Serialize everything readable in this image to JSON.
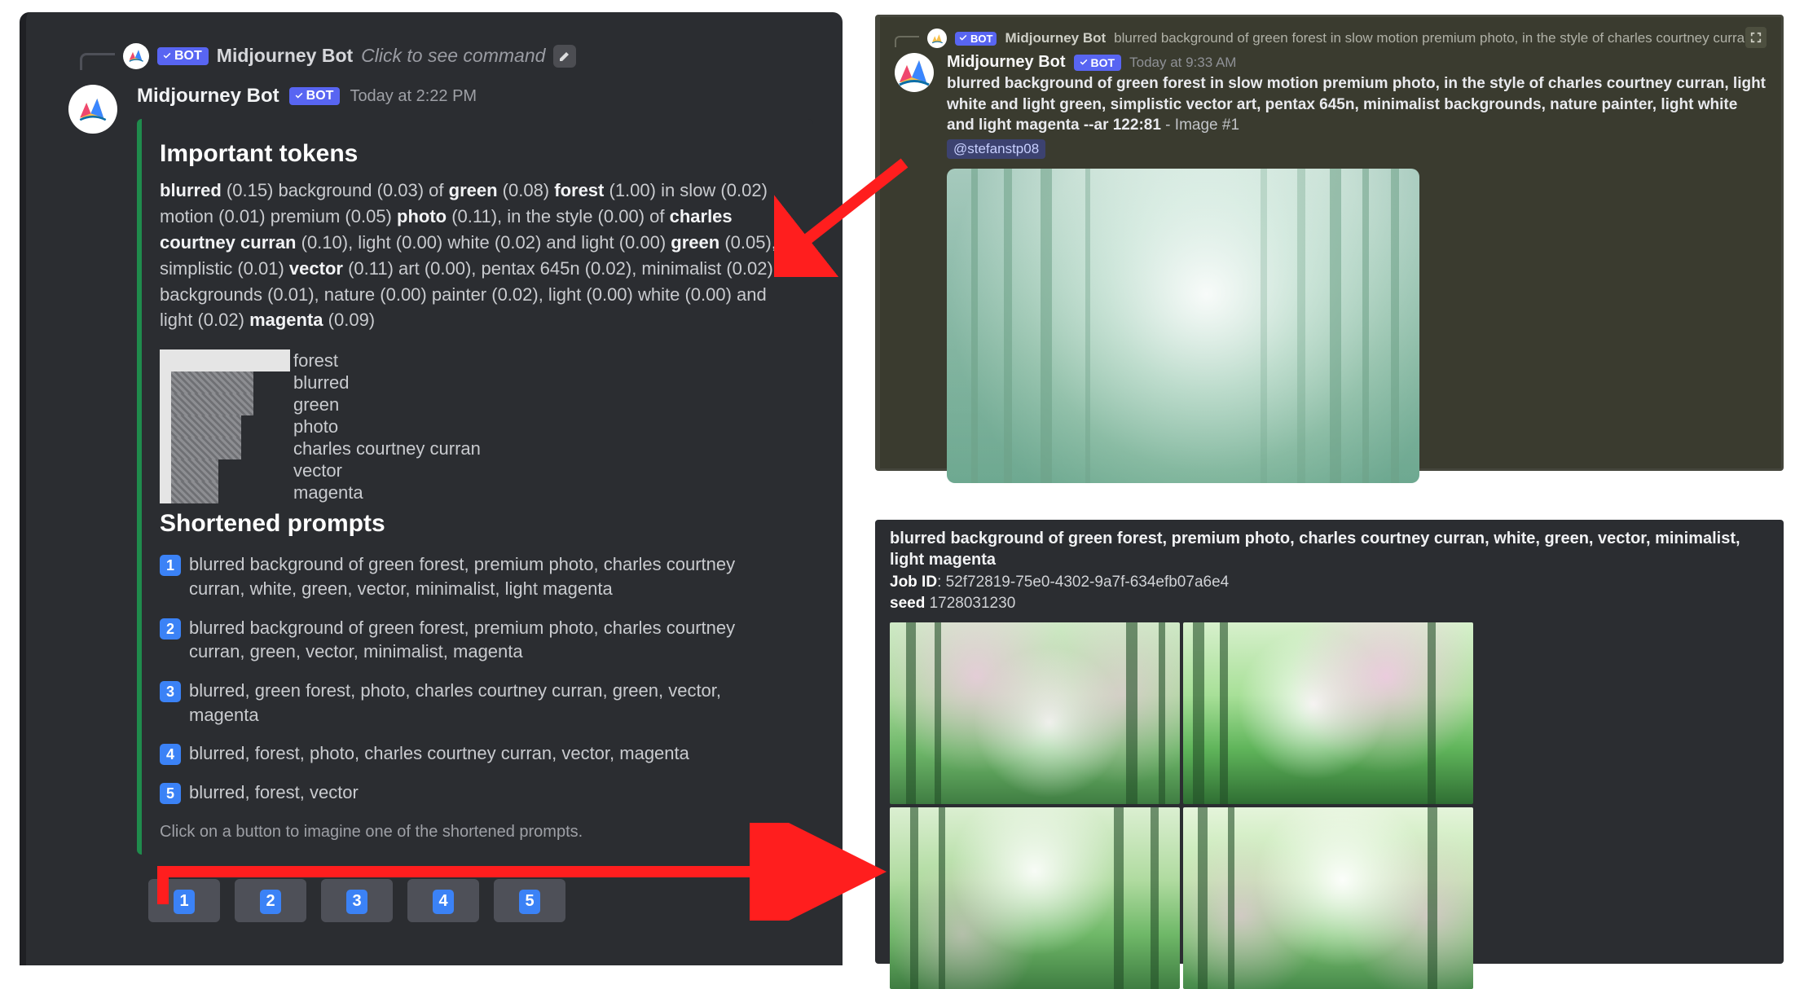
{
  "left": {
    "mention": {
      "bot_tag": "BOT",
      "name": "Midjourney Bot",
      "click_hint": "Click to see command"
    },
    "header": {
      "name": "Midjourney Bot",
      "bot_tag": "BOT",
      "time": "Today at 2:22 PM"
    },
    "embed": {
      "heading1": "Important tokens",
      "tokens": [
        {
          "t": "blurred",
          "b": true
        },
        {
          "t": " (0.15) background (0.03) of "
        },
        {
          "t": "green",
          "b": true
        },
        {
          "t": " (0.08) "
        },
        {
          "t": "forest",
          "b": true
        },
        {
          "t": " (1.00) in slow (0.02) motion (0.01) premium (0.05) "
        },
        {
          "t": "photo",
          "b": true
        },
        {
          "t": " (0.11), in the style (0.00) of "
        },
        {
          "t": "charles courtney curran",
          "b": true
        },
        {
          "t": " (0.10), light (0.00) white (0.02) and light (0.00) "
        },
        {
          "t": "green",
          "b": true
        },
        {
          "t": " (0.05), simplistic (0.01) "
        },
        {
          "t": "vector",
          "b": true
        },
        {
          "t": " (0.11) art (0.00), pentax 645n (0.02), minimalist (0.02) backgrounds (0.01), nature (0.00) painter (0.02), light (0.00) white (0.00) and light (0.02) "
        },
        {
          "t": "magenta",
          "b": true
        },
        {
          "t": " (0.09)"
        }
      ],
      "bars": [
        {
          "label": "forest",
          "solid": 160,
          "dim": 0
        },
        {
          "label": "blurred",
          "solid": 14,
          "dim": 101
        },
        {
          "label": "green",
          "solid": 14,
          "dim": 101
        },
        {
          "label": "photo",
          "solid": 14,
          "dim": 86
        },
        {
          "label": "charles courtney curran",
          "solid": 14,
          "dim": 86
        },
        {
          "label": "vector",
          "solid": 14,
          "dim": 58
        },
        {
          "label": "magenta",
          "solid": 14,
          "dim": 58
        }
      ],
      "heading2": "Shortened prompts",
      "shortened": [
        "blurred background of green forest, premium photo, charles courtney curran, white, green, vector, minimalist, light magenta",
        "blurred background of green forest, premium photo, charles courtney curran, green, vector, minimalist, magenta",
        "blurred, green forest, photo, charles courtney curran, green, vector, magenta",
        "blurred, forest, photo, charles courtney curran, vector, magenta",
        "blurred, forest, vector"
      ],
      "hint": "Click on a button to imagine one of the shortened prompts."
    },
    "buttons": [
      "1",
      "2",
      "3",
      "4",
      "5"
    ]
  },
  "right_top": {
    "tiny_header": {
      "name": "Midjourney Bot",
      "bot_tag": "BOT",
      "truncated_prompt": "blurred background of green forest in slow motion premium photo, in the style of charles courtney curran, light white and ligh"
    },
    "main": {
      "name": "Midjourney Bot",
      "bot_tag": "BOT",
      "time": "Today at 9:33 AM",
      "prompt": "blurred background of green forest in slow motion premium photo, in the style of charles courtney curran, light white and light green, simplistic vector art, pentax 645n, minimalist backgrounds, nature painter, light white and light magenta --ar 122:81",
      "suffix": " - Image #1",
      "mention": "@stefanstp08"
    }
  },
  "right_bottom": {
    "prompt": "blurred background of green forest, premium photo, charles courtney curran, white, green, vector, minimalist, light magenta",
    "job_label": "Job ID",
    "job_id": ": 52f72819-75e0-4302-9a7f-634efb07a6e4",
    "seed_label": "seed",
    "seed": " 1728031230"
  }
}
